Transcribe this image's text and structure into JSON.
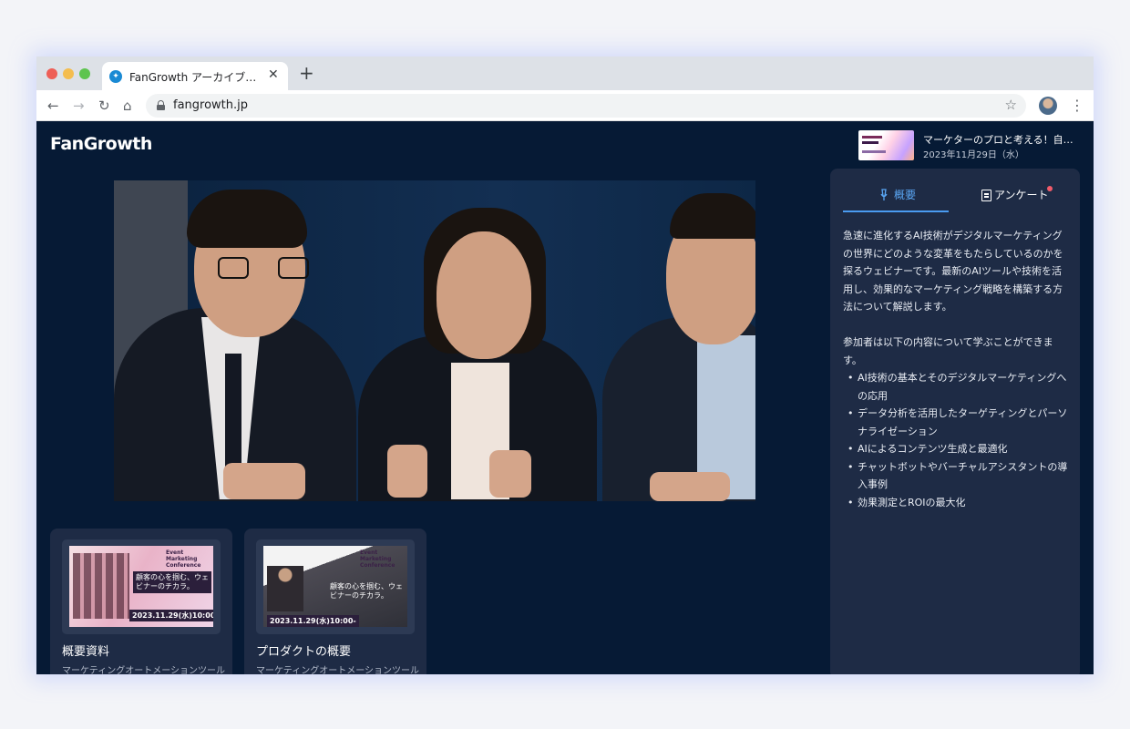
{
  "browser": {
    "tab_title": "FanGrowth アーカイブ配信...",
    "tab_close": "✕",
    "new_tab": "+",
    "url": "fangrowth.jp",
    "back": "←",
    "forward": "→",
    "reload": "↻",
    "home": "⌂",
    "star": "☆",
    "menu": "⋮"
  },
  "header": {
    "logo": "FanGrowth",
    "event": {
      "title": "マーケターのプロと考える！自分に…",
      "date": "2023年11月29日（水）"
    }
  },
  "panel": {
    "tabs": [
      {
        "label": "概要",
        "icon": "microphone-icon",
        "active": true
      },
      {
        "label": "アンケート",
        "icon": "clipboard-icon",
        "notification": true
      }
    ],
    "paragraph1": "急速に進化するAI技術がデジタルマーケティングの世界にどのような変革をもたらしているのかを探るウェビナーです。最新のAIツールや技術を活用し、効果的なマーケティング戦略を構築する方法について解説します。",
    "paragraph2": "参加者は以下の内容について学ぶことができます。",
    "bullets": [
      "AI技術の基本とそのデジタルマーケティングへの応用",
      "データ分析を活用したターゲティングとパーソナライゼーション",
      "AIによるコンテンツ生成と最適化",
      "チャットボットやバーチャルアシスタントの導入事例",
      "効果測定とROIの最大化"
    ]
  },
  "cards": [
    {
      "title": "概要資料",
      "subtitle": "マーケティングオートメーションツール",
      "thumb": {
        "label": "Event Marketing Conference",
        "copy": "顧客の心を掴む、ウェビナーのチカラ。",
        "date": "2023.11.29(水)10:00-"
      }
    },
    {
      "title": "プロダクトの概要",
      "subtitle": "マーケティングオートメーションツール",
      "thumb": {
        "label": "Event Marketing Conference",
        "copy": "顧客の心を掴む、ウェビナーのチカラ。",
        "date": "2023.11.29(水)10:00-"
      }
    }
  ],
  "colors": {
    "accent": "#4a9bf0",
    "page_bg": "#061a35",
    "panel_bg": "#1e2b45",
    "notification": "#f25b6a"
  }
}
